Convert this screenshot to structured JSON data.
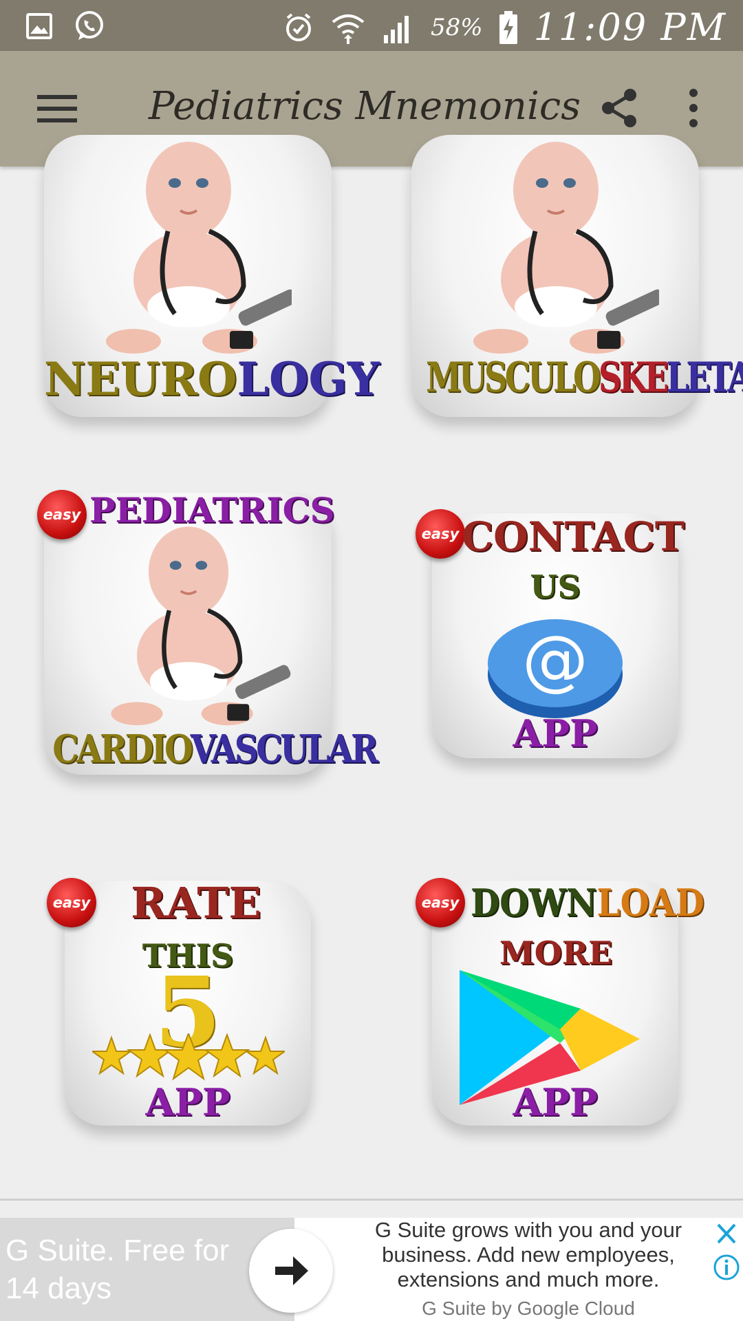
{
  "status_bar": {
    "icons": [
      "gallery-icon",
      "whatsapp-icon",
      "alarm-icon",
      "wifi-icon",
      "signal-icon",
      "battery-charging-icon"
    ],
    "battery": "58%",
    "time": "11:09 PM"
  },
  "toolbar": {
    "title": "Pediatrics Mnemonics",
    "menu_icon": "hamburger-menu-icon",
    "share_icon": "share-icon",
    "more_icon": "more-vertical-icon"
  },
  "tiles": [
    {
      "id": "neurology",
      "label_parts": [
        "NEURO",
        "LOGY"
      ]
    },
    {
      "id": "musculoskeletal",
      "label_parts": [
        "MUSCULO",
        "SKE",
        "LETAL"
      ]
    },
    {
      "id": "cardiovascular",
      "badge": "easy",
      "top": "PEDIATRICS",
      "label_parts": [
        "CARDIO",
        "VASCULAR"
      ]
    },
    {
      "id": "contact",
      "badge": "easy",
      "lines": [
        "CONTACT",
        "US",
        "APP"
      ],
      "icon": "at-sign-icon"
    },
    {
      "id": "rate",
      "badge": "easy",
      "lines": [
        "RATE",
        "THIS",
        "5",
        "APP"
      ],
      "icon": "five-stars-icon"
    },
    {
      "id": "download",
      "badge": "easy",
      "top_parts": [
        "DOWN",
        "LOAD"
      ],
      "lines": [
        "MORE",
        "APP"
      ],
      "icon": "google-play-icon"
    }
  ],
  "ad": {
    "headline": "G Suite. Free for 14 days",
    "body": "G Suite grows with you and your business. Add new employees, extensions and much more.",
    "sponsor": "G Suite by Google Cloud",
    "arrow_icon": "arrow-right-icon",
    "close_icon": "close-icon",
    "info_icon": "info-icon"
  },
  "colors": {
    "status_bar": "#807b6c",
    "toolbar": "#a9a391",
    "background": "#eeeeee"
  }
}
